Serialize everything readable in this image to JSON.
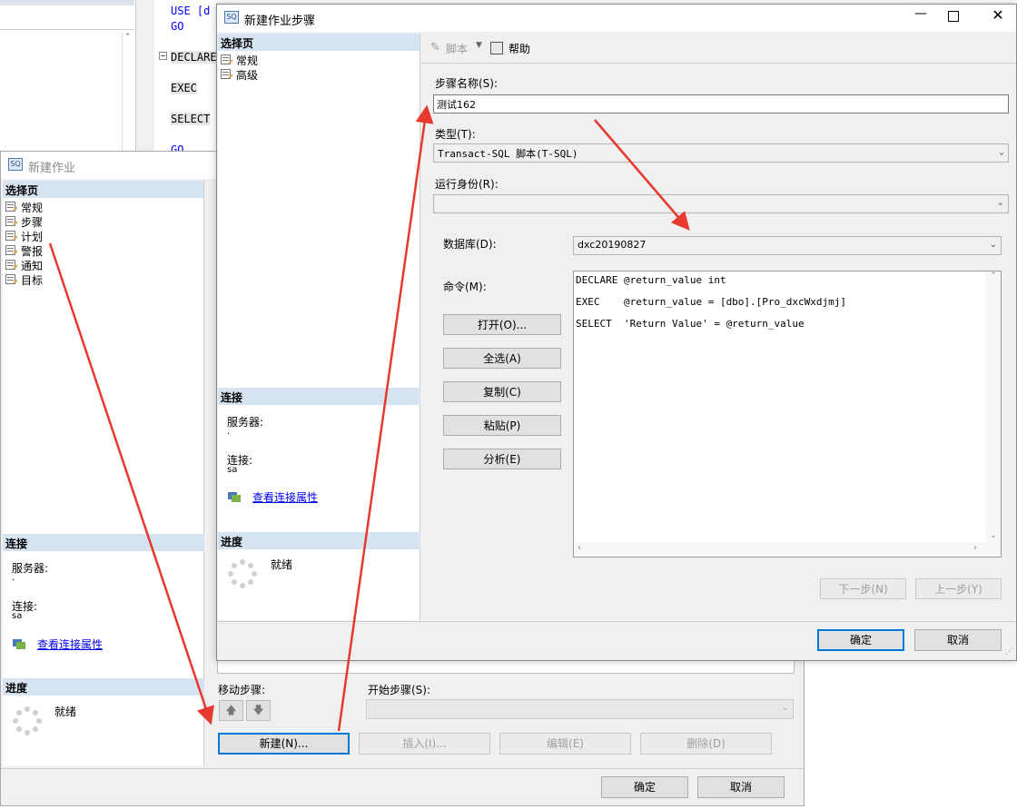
{
  "editor": {
    "lines": [
      "USE [d",
      "GO",
      "DECLARE",
      "EXEC",
      "SELECT",
      "GO"
    ]
  },
  "job_window": {
    "title": "新建作业",
    "select_page_header": "选择页",
    "pages": [
      "常规",
      "步骤",
      "计划",
      "警报",
      "通知",
      "目标"
    ],
    "connection_header": "连接",
    "server_label": "服务器:",
    "server_value": ".",
    "connection_label": "连接:",
    "connection_value": "sa",
    "view_props_link": "查看连接属性",
    "progress_header": "进度",
    "progress_status": "就绪",
    "move_steps_label": "移动步骤:",
    "start_step_label": "开始步骤(S):",
    "new_button": "新建(N)...",
    "insert_button": "插入(I)...",
    "edit_button": "编辑(E)",
    "delete_button": "删除(D)",
    "ok_button": "确定",
    "cancel_button": "取消"
  },
  "step_window": {
    "title": "新建作业步骤",
    "select_page_header": "选择页",
    "pages": [
      "常规",
      "高级"
    ],
    "toolbar": {
      "script": "脚本",
      "help": "帮助"
    },
    "step_name_label": "步骤名称(S):",
    "step_name_value": "测试162",
    "type_label": "类型(T):",
    "type_value": "Transact-SQL 脚本(T-SQL)",
    "run_as_label": "运行身份(R):",
    "run_as_value": "",
    "database_label": "数据库(D):",
    "database_value": "dxc20190827",
    "command_label": "命令(M):",
    "command_lines": [
      "DECLARE @return_value int",
      "EXEC    @return_value = [dbo].[Pro_dxcWxdjmj]",
      "SELECT  'Return Value' = @return_value"
    ],
    "open_button": "打开(O)...",
    "select_all_button": "全选(A)",
    "copy_button": "复制(C)",
    "paste_button": "粘贴(P)",
    "parse_button": "分析(E)",
    "next_button": "下一步(N)",
    "prev_button": "上一步(Y)",
    "connection_header": "连接",
    "server_label": "服务器:",
    "server_value": ".",
    "connection_label": "连接:",
    "connection_value": "sa",
    "view_props_link": "查看连接属性",
    "progress_header": "进度",
    "progress_status": "就绪",
    "ok_button": "确定",
    "cancel_button": "取消"
  },
  "colors": {
    "annotation_arrow": "#e8392e",
    "header_bg": "#d6e3f0",
    "accent": "#0078d7"
  }
}
